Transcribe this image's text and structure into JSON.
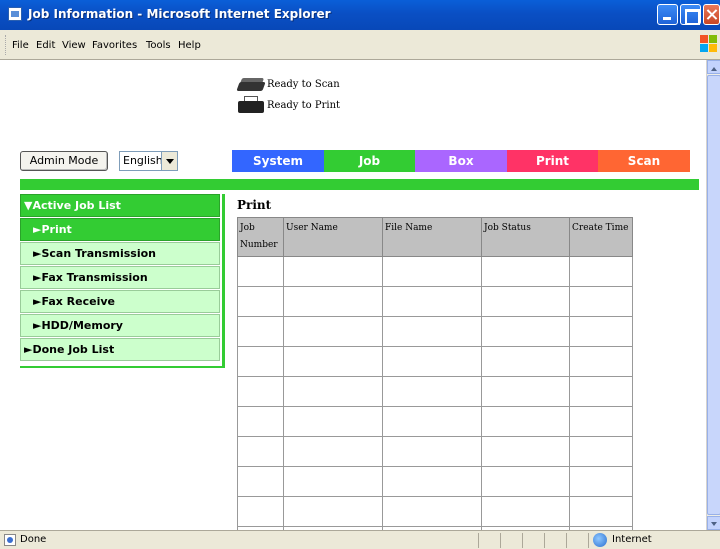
{
  "window": {
    "title": "Job Information - Microsoft Internet Explorer"
  },
  "menu": [
    "File",
    "Edit",
    "View",
    "Favorites",
    "Tools",
    "Help"
  ],
  "status": {
    "scan": "Ready to Scan",
    "print": "Ready to Print"
  },
  "controls": {
    "admin_mode": "Admin Mode",
    "language": "English"
  },
  "tabs": [
    {
      "label": "System",
      "color": "#3366ff"
    },
    {
      "label": "Job",
      "color": "#33cc33"
    },
    {
      "label": "Box",
      "color": "#aa66ff"
    },
    {
      "label": "Print",
      "color": "#ff3366"
    },
    {
      "label": "Scan",
      "color": "#ff6633"
    }
  ],
  "sidebar": [
    {
      "label": "▼Active Job List"
    },
    {
      "label": "►Print"
    },
    {
      "label": "►Scan Transmission"
    },
    {
      "label": "►Fax Transmission"
    },
    {
      "label": "►Fax Receive"
    },
    {
      "label": "►HDD/Memory"
    },
    {
      "label": "►Done Job List"
    }
  ],
  "section": {
    "title": "Print"
  },
  "table": {
    "headers": [
      "Job Number",
      "User Name",
      "File Name",
      "Job Status",
      "Create Time"
    ]
  },
  "statusbar": {
    "text": "Done",
    "zone": "Internet"
  }
}
